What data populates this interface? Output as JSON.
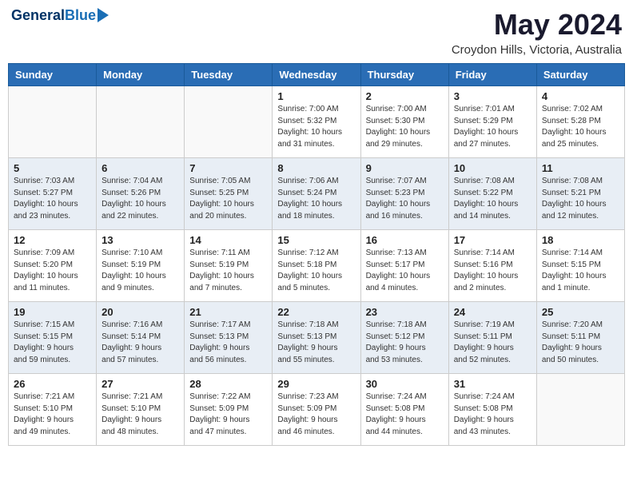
{
  "header": {
    "logo_line1": "General",
    "logo_line2": "Blue",
    "month": "May 2024",
    "location": "Croydon Hills, Victoria, Australia"
  },
  "days_of_week": [
    "Sunday",
    "Monday",
    "Tuesday",
    "Wednesday",
    "Thursday",
    "Friday",
    "Saturday"
  ],
  "weeks": [
    [
      {
        "day": "",
        "info": ""
      },
      {
        "day": "",
        "info": ""
      },
      {
        "day": "",
        "info": ""
      },
      {
        "day": "1",
        "info": "Sunrise: 7:00 AM\nSunset: 5:32 PM\nDaylight: 10 hours\nand 31 minutes."
      },
      {
        "day": "2",
        "info": "Sunrise: 7:00 AM\nSunset: 5:30 PM\nDaylight: 10 hours\nand 29 minutes."
      },
      {
        "day": "3",
        "info": "Sunrise: 7:01 AM\nSunset: 5:29 PM\nDaylight: 10 hours\nand 27 minutes."
      },
      {
        "day": "4",
        "info": "Sunrise: 7:02 AM\nSunset: 5:28 PM\nDaylight: 10 hours\nand 25 minutes."
      }
    ],
    [
      {
        "day": "5",
        "info": "Sunrise: 7:03 AM\nSunset: 5:27 PM\nDaylight: 10 hours\nand 23 minutes."
      },
      {
        "day": "6",
        "info": "Sunrise: 7:04 AM\nSunset: 5:26 PM\nDaylight: 10 hours\nand 22 minutes."
      },
      {
        "day": "7",
        "info": "Sunrise: 7:05 AM\nSunset: 5:25 PM\nDaylight: 10 hours\nand 20 minutes."
      },
      {
        "day": "8",
        "info": "Sunrise: 7:06 AM\nSunset: 5:24 PM\nDaylight: 10 hours\nand 18 minutes."
      },
      {
        "day": "9",
        "info": "Sunrise: 7:07 AM\nSunset: 5:23 PM\nDaylight: 10 hours\nand 16 minutes."
      },
      {
        "day": "10",
        "info": "Sunrise: 7:08 AM\nSunset: 5:22 PM\nDaylight: 10 hours\nand 14 minutes."
      },
      {
        "day": "11",
        "info": "Sunrise: 7:08 AM\nSunset: 5:21 PM\nDaylight: 10 hours\nand 12 minutes."
      }
    ],
    [
      {
        "day": "12",
        "info": "Sunrise: 7:09 AM\nSunset: 5:20 PM\nDaylight: 10 hours\nand 11 minutes."
      },
      {
        "day": "13",
        "info": "Sunrise: 7:10 AM\nSunset: 5:19 PM\nDaylight: 10 hours\nand 9 minutes."
      },
      {
        "day": "14",
        "info": "Sunrise: 7:11 AM\nSunset: 5:19 PM\nDaylight: 10 hours\nand 7 minutes."
      },
      {
        "day": "15",
        "info": "Sunrise: 7:12 AM\nSunset: 5:18 PM\nDaylight: 10 hours\nand 5 minutes."
      },
      {
        "day": "16",
        "info": "Sunrise: 7:13 AM\nSunset: 5:17 PM\nDaylight: 10 hours\nand 4 minutes."
      },
      {
        "day": "17",
        "info": "Sunrise: 7:14 AM\nSunset: 5:16 PM\nDaylight: 10 hours\nand 2 minutes."
      },
      {
        "day": "18",
        "info": "Sunrise: 7:14 AM\nSunset: 5:15 PM\nDaylight: 10 hours\nand 1 minute."
      }
    ],
    [
      {
        "day": "19",
        "info": "Sunrise: 7:15 AM\nSunset: 5:15 PM\nDaylight: 9 hours\nand 59 minutes."
      },
      {
        "day": "20",
        "info": "Sunrise: 7:16 AM\nSunset: 5:14 PM\nDaylight: 9 hours\nand 57 minutes."
      },
      {
        "day": "21",
        "info": "Sunrise: 7:17 AM\nSunset: 5:13 PM\nDaylight: 9 hours\nand 56 minutes."
      },
      {
        "day": "22",
        "info": "Sunrise: 7:18 AM\nSunset: 5:13 PM\nDaylight: 9 hours\nand 55 minutes."
      },
      {
        "day": "23",
        "info": "Sunrise: 7:18 AM\nSunset: 5:12 PM\nDaylight: 9 hours\nand 53 minutes."
      },
      {
        "day": "24",
        "info": "Sunrise: 7:19 AM\nSunset: 5:11 PM\nDaylight: 9 hours\nand 52 minutes."
      },
      {
        "day": "25",
        "info": "Sunrise: 7:20 AM\nSunset: 5:11 PM\nDaylight: 9 hours\nand 50 minutes."
      }
    ],
    [
      {
        "day": "26",
        "info": "Sunrise: 7:21 AM\nSunset: 5:10 PM\nDaylight: 9 hours\nand 49 minutes."
      },
      {
        "day": "27",
        "info": "Sunrise: 7:21 AM\nSunset: 5:10 PM\nDaylight: 9 hours\nand 48 minutes."
      },
      {
        "day": "28",
        "info": "Sunrise: 7:22 AM\nSunset: 5:09 PM\nDaylight: 9 hours\nand 47 minutes."
      },
      {
        "day": "29",
        "info": "Sunrise: 7:23 AM\nSunset: 5:09 PM\nDaylight: 9 hours\nand 46 minutes."
      },
      {
        "day": "30",
        "info": "Sunrise: 7:24 AM\nSunset: 5:08 PM\nDaylight: 9 hours\nand 44 minutes."
      },
      {
        "day": "31",
        "info": "Sunrise: 7:24 AM\nSunset: 5:08 PM\nDaylight: 9 hours\nand 43 minutes."
      },
      {
        "day": "",
        "info": ""
      }
    ]
  ]
}
